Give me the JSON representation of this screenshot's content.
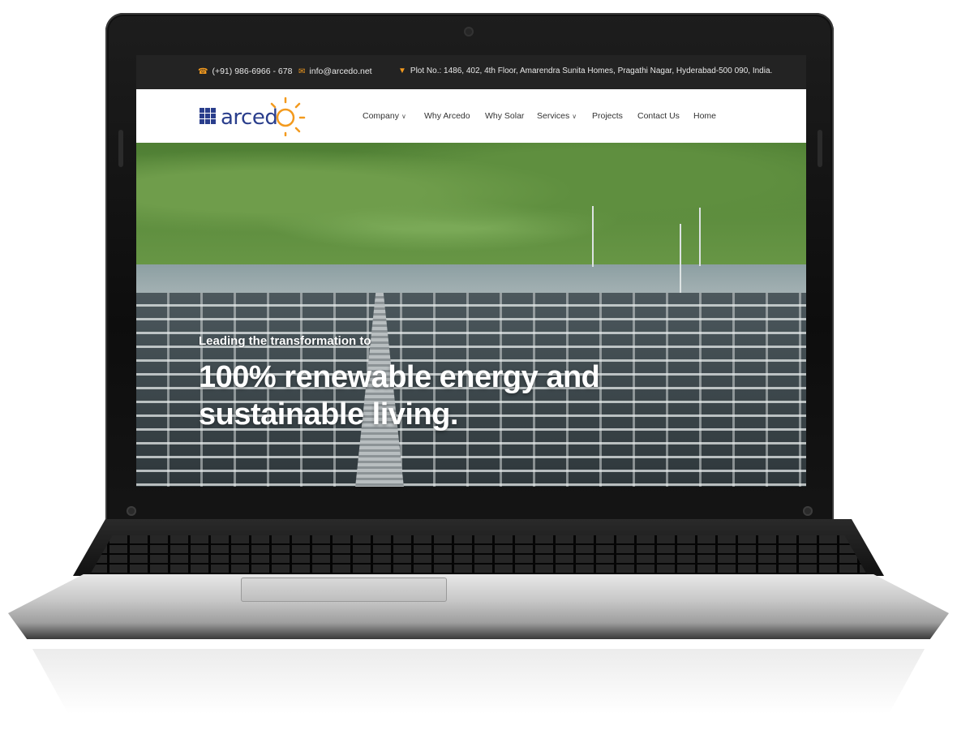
{
  "topbar": {
    "phone": "(+91) 986-6966 - 678",
    "email": "info@arcedo.net",
    "address": "Plot No.: 1486, 402, 4th Floor, Amarendra Sunita Homes, Pragathi Nagar, Hyderabad-500 090, India.",
    "icon_color": "#f39a1e"
  },
  "logo": {
    "text": "arced",
    "text_color": "#2a3e8c",
    "sun_color": "#f39a1e"
  },
  "nav": {
    "items": [
      {
        "label": "Company",
        "dropdown": true
      },
      {
        "label": "Why Arcedo",
        "dropdown": false
      },
      {
        "label": "Why Solar",
        "dropdown": false
      },
      {
        "label": "Services",
        "dropdown": true
      },
      {
        "label": "Projects",
        "dropdown": false
      },
      {
        "label": "Contact Us",
        "dropdown": false
      },
      {
        "label": "Home",
        "dropdown": false
      }
    ]
  },
  "hero": {
    "subtitle": "Leading the transformation to",
    "title_line1": "100% renewable energy and",
    "title_line2": "sustainable living."
  }
}
